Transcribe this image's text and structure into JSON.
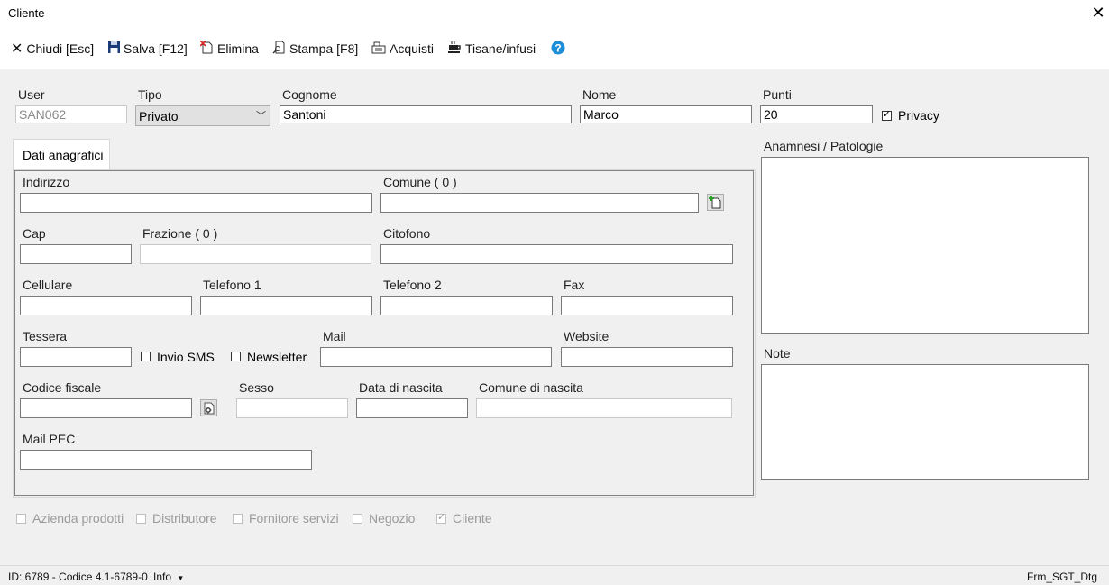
{
  "window": {
    "title": "Cliente"
  },
  "toolbar": {
    "close": "Chiudi [Esc]",
    "save": "Salva [F12]",
    "delete": "Elimina",
    "print": "Stampa [F8]",
    "purchases": "Acquisti",
    "herbal": "Tisane/infusi"
  },
  "header": {
    "user_label": "User",
    "user_value": "SAN062",
    "tipo_label": "Tipo",
    "tipo_value": "Privato",
    "cognome_label": "Cognome",
    "cognome_value": "Santoni",
    "nome_label": "Nome",
    "nome_value": "Marco",
    "punti_label": "Punti",
    "punti_value": "20",
    "privacy_label": "Privacy",
    "privacy_checked": true
  },
  "tab": {
    "label": "Dati anagrafici"
  },
  "form": {
    "indirizzo": "Indirizzo",
    "comune": "Comune ( 0 )",
    "cap": "Cap",
    "frazione": "Frazione ( 0 )",
    "citofono": "Citofono",
    "cellulare": "Cellulare",
    "telefono1": "Telefono 1",
    "telefono2": "Telefono 2",
    "fax": "Fax",
    "tessera": "Tessera",
    "invio_sms": "Invio SMS",
    "newsletter": "Newsletter",
    "mail": "Mail",
    "website": "Website",
    "codice_fiscale": "Codice fiscale",
    "sesso": "Sesso",
    "data_nascita": "Data di nascita",
    "comune_nascita": "Comune di nascita",
    "mail_pec": "Mail PEC"
  },
  "side": {
    "anamnesi": "Anamnesi / Patologie",
    "note": "Note"
  },
  "roles": {
    "azienda": "Azienda prodotti",
    "distributore": "Distributore",
    "fornitore": "Fornitore servizi",
    "negozio": "Negozio",
    "cliente": "Cliente"
  },
  "status": {
    "id": "ID: 6789 - Codice 4.1-6789-0",
    "info": "Info",
    "form_name": "Frm_SGT_Dtg"
  },
  "colors": {
    "help_icon": "#1e8fd6"
  }
}
